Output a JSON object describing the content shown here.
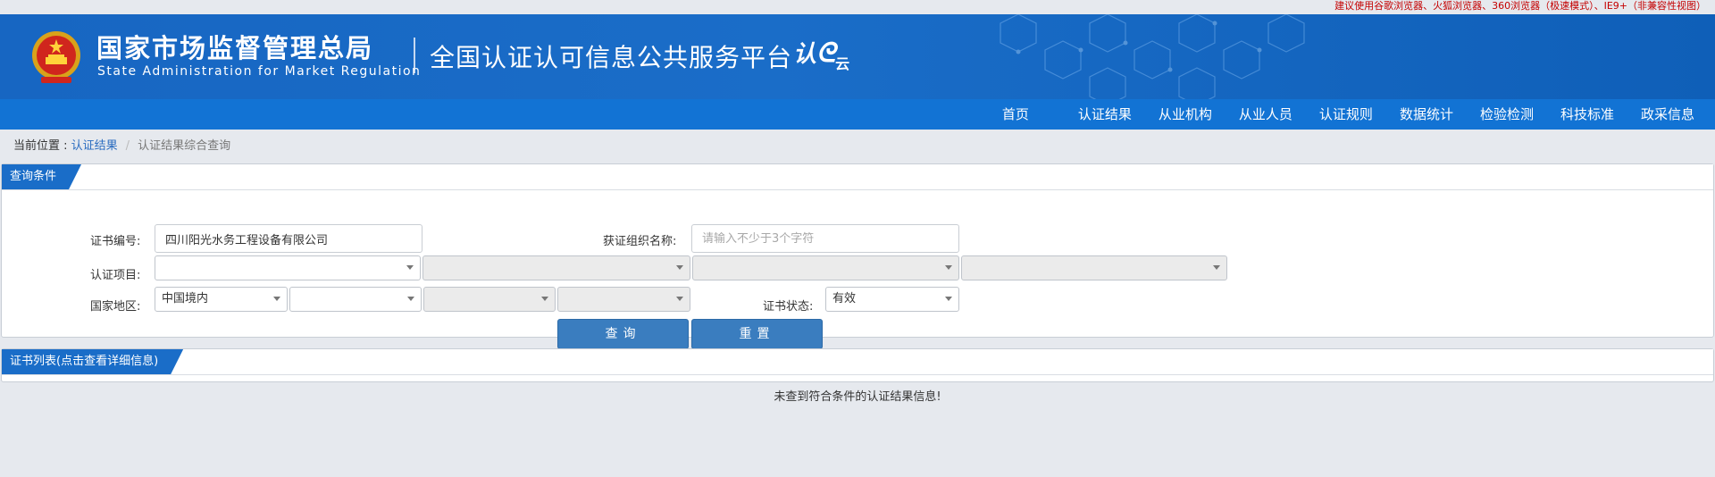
{
  "top_notice": "建议使用谷歌浏览器、火狐浏览器、360浏览器（极速模式）、IE9+（非兼容性视图）",
  "header": {
    "org_cn": "国家市场监督管理总局",
    "org_en": "State Administration  for  Market Regulation",
    "platform": "全国认证认可信息公共服务平台",
    "logo_text_1": "认",
    "logo_text_2": "云"
  },
  "nav": {
    "items": [
      "首页",
      "认证结果",
      "从业机构",
      "从业人员",
      "认证规则",
      "数据统计",
      "检验检测",
      "科技标准",
      "政采信息"
    ]
  },
  "breadcrumb": {
    "prefix": "当前位置 : ",
    "link": "认证结果",
    "separator": "/",
    "current": "认证结果综合查询"
  },
  "query": {
    "title": "查询条件",
    "cert_no_label": "证书编号:",
    "cert_no_value": "四川阳光水务工程设备有限公司",
    "org_name_label": "获证组织名称:",
    "org_name_placeholder": "请输入不少于3个字符",
    "project_label": "认证项目:",
    "region_label": "国家地区:",
    "region_value": "中国境内",
    "status_label": "证书状态:",
    "status_value": "有效",
    "search_button": "查询",
    "reset_button": "重置"
  },
  "list": {
    "title": "证书列表(点击查看详细信息)",
    "empty_message": "未查到符合条件的认证结果信息!"
  },
  "colors": {
    "header_blue": "#1766c2",
    "nav_blue": "#1273d4",
    "button_blue": "#3a7dbf",
    "notice_red": "#c40000"
  }
}
